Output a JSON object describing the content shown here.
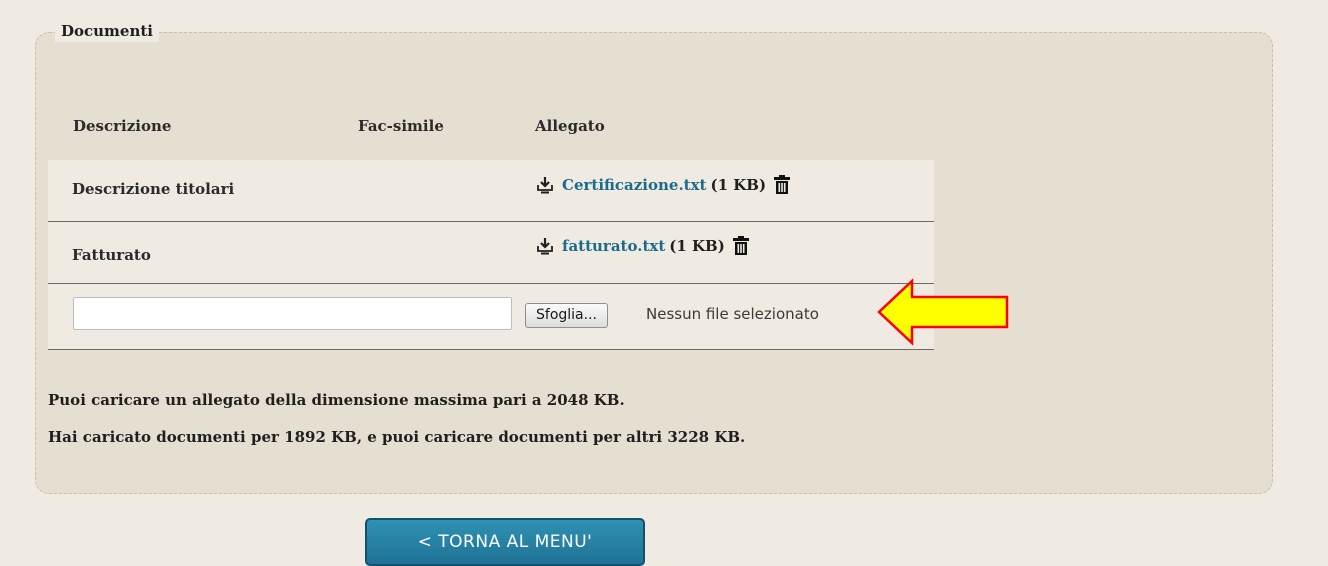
{
  "section": {
    "legend": "Documenti"
  },
  "table": {
    "headers": {
      "descrizione": "Descrizione",
      "facsimile": "Fac-simile",
      "allegato": "Allegato"
    },
    "rows": [
      {
        "label": "Descrizione titolari",
        "file_name": "Certificazione.txt",
        "file_size": "(1 KB)"
      },
      {
        "label": "Fatturato",
        "file_name": "fatturato.txt",
        "file_size": "(1 KB)"
      }
    ]
  },
  "upload": {
    "description_value": "",
    "browse_label": "Sfoglia...",
    "no_file_text": "Nessun file selezionato"
  },
  "info": {
    "max_size": "Puoi caricare un allegato della dimensione massima pari a 2048 KB.",
    "uploaded": "Hai caricato documenti per 1892 KB, e puoi caricare documenti per altri 3228 KB."
  },
  "nav": {
    "back_label": "< TORNA AL MENU'"
  },
  "colors": {
    "link": "#1d6a8a",
    "button": "#1e7396",
    "arrow_fill": "#ffff00",
    "arrow_stroke": "#ff0000"
  },
  "icons": {
    "download": "download-icon",
    "trash": "trash-icon",
    "annotation": "arrow-left-icon"
  }
}
